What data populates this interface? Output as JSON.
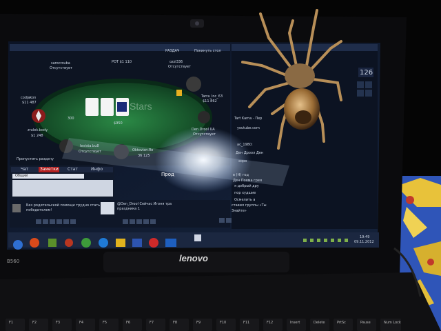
{
  "poker": {
    "top_labels": [
      "РАЗДАЧ",
      "Покинуть стол"
    ],
    "pot": "POT $1 110",
    "seats": [
      {
        "name": "sarocrouba",
        "status": "Отсутствует"
      },
      {
        "name": "ozzi336",
        "status": "Отсутствует"
      },
      {
        "name": "codjakon",
        "stack": "$11 487"
      },
      {
        "name": "Tarra_Inc_63",
        "stack": "$11 862"
      },
      {
        "name": "zrulek.body",
        "stack": "$1 248"
      },
      {
        "name": "Den Drool UA",
        "stack": "Отсутствует"
      },
      {
        "name": "levista.bu8",
        "status": "Отсутствует"
      },
      {
        "name": "Oktovian.Ro",
        "stack": "36 125"
      }
    ],
    "chip_amount": "300",
    "seat_amount": "$950",
    "checkbox_label": "Пропустить раздачу",
    "logo_text": "Stars"
  },
  "chat": {
    "tabs": [
      "Чат",
      "Заметки",
      "Стат",
      "Инфо"
    ],
    "select_value": "Общий",
    "lines": [
      "Без родительской помощи трудно стать",
      "победителем!",
      "@Den_Drool Сейчас Игоня тра",
      "праздника 1"
    ],
    "action_label": "Прод"
  },
  "lobby": {
    "counter": "126",
    "lines": [
      "Tart Karna - Пер",
      "youtube.com",
      "ac_1980:",
      "Ден Дроол Ден",
      "хоро",
      "в (H) год",
      "Ден Пояма грея",
      "я добрый дру",
      "пор худшие",
      "Осмелить а",
      "ставил группы «Ты",
      "Знайте»"
    ]
  },
  "taskbar": {
    "time": "19:49",
    "date": "09.11.2012"
  },
  "laptop": {
    "brand": "lenovo",
    "model": "B560",
    "keys": [
      "F1",
      "F2",
      "F3",
      "F4",
      "F5",
      "F6",
      "F7",
      "F8",
      "F9",
      "F10",
      "F11",
      "F12",
      "Insert",
      "Delete",
      "PrtSc",
      "Pause",
      "Num Lock"
    ]
  },
  "colors": {
    "desk_bg": "#050505",
    "felt": "#1e6b36",
    "screen_bg": "#101a2c",
    "taskbar": "#1b2740",
    "fabric_blue": "#2f55b8",
    "fabric_yellow": "#e8c23a",
    "spider": "#b88f58"
  }
}
